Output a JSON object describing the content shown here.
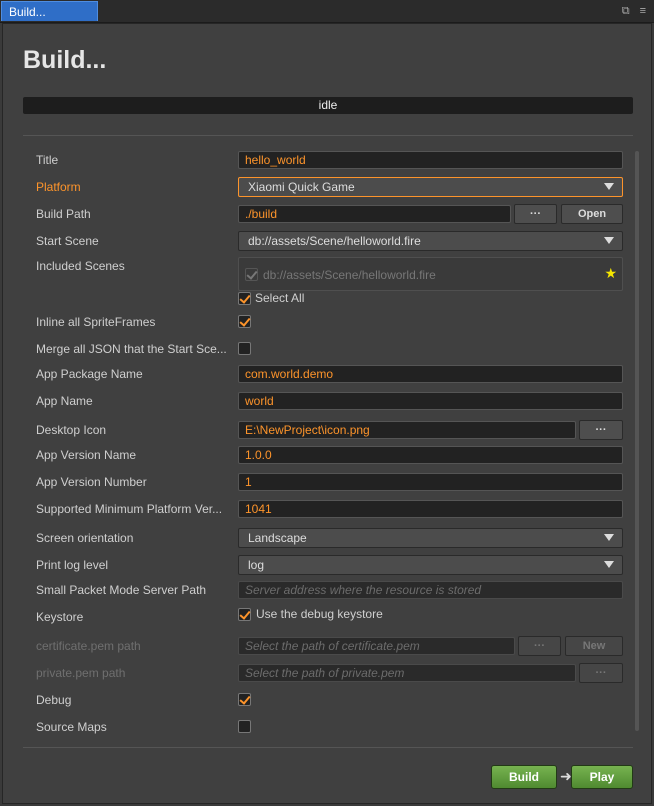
{
  "tab": {
    "title": "Build...",
    "restore_icon": "restore-icon",
    "menu_icon": "menu-icon"
  },
  "heading": "Build...",
  "status": "idle",
  "colors": {
    "accent": "#fd942b",
    "tab": "#2f6ec7",
    "green": "#5fa03a"
  },
  "fields": {
    "title": {
      "label": "Title",
      "value": "hello_world"
    },
    "platform": {
      "label": "Platform",
      "value": "Xiaomi Quick Game"
    },
    "build_path": {
      "label": "Build Path",
      "value": "./build",
      "browse": "···",
      "open": "Open"
    },
    "start_scene": {
      "label": "Start Scene",
      "value": "db://assets/Scene/helloworld.fire"
    },
    "included_scenes": {
      "label": "Included Scenes",
      "scene": "db://assets/Scene/helloworld.fire",
      "select_all": "Select All"
    },
    "inline_sprite": {
      "label": "Inline all SpriteFrames"
    },
    "merge_json": {
      "label": "Merge all JSON that the Start Sce..."
    },
    "package_name": {
      "label": "App Package Name",
      "value": "com.world.demo"
    },
    "app_name": {
      "label": "App Name",
      "value": "world"
    },
    "desktop_icon": {
      "label": "Desktop Icon",
      "value": "E:\\NewProject\\icon.png",
      "browse": "···"
    },
    "version_name": {
      "label": "App Version Name",
      "value": "1.0.0"
    },
    "version_number": {
      "label": "App Version Number",
      "value": "1"
    },
    "min_platform": {
      "label": "Supported Minimum Platform Ver...",
      "value": "1041"
    },
    "orientation": {
      "label": "Screen orientation",
      "value": "Landscape"
    },
    "log_level": {
      "label": "Print log level",
      "value": "log"
    },
    "small_packet": {
      "label": "Small Packet Mode Server Path",
      "placeholder": "Server address where the resource is stored"
    },
    "keystore": {
      "label": "Keystore",
      "option": "Use the debug keystore"
    },
    "certificate": {
      "label": "certificate.pem path",
      "placeholder": "Select the path of certificate.pem",
      "browse": "···",
      "new": "New"
    },
    "private_pem": {
      "label": "private.pem path",
      "placeholder": "Select the path of private.pem",
      "browse": "···"
    },
    "debug": {
      "label": "Debug"
    },
    "source_maps": {
      "label": "Source Maps"
    }
  },
  "actions": {
    "build": "Build",
    "play": "Play"
  }
}
